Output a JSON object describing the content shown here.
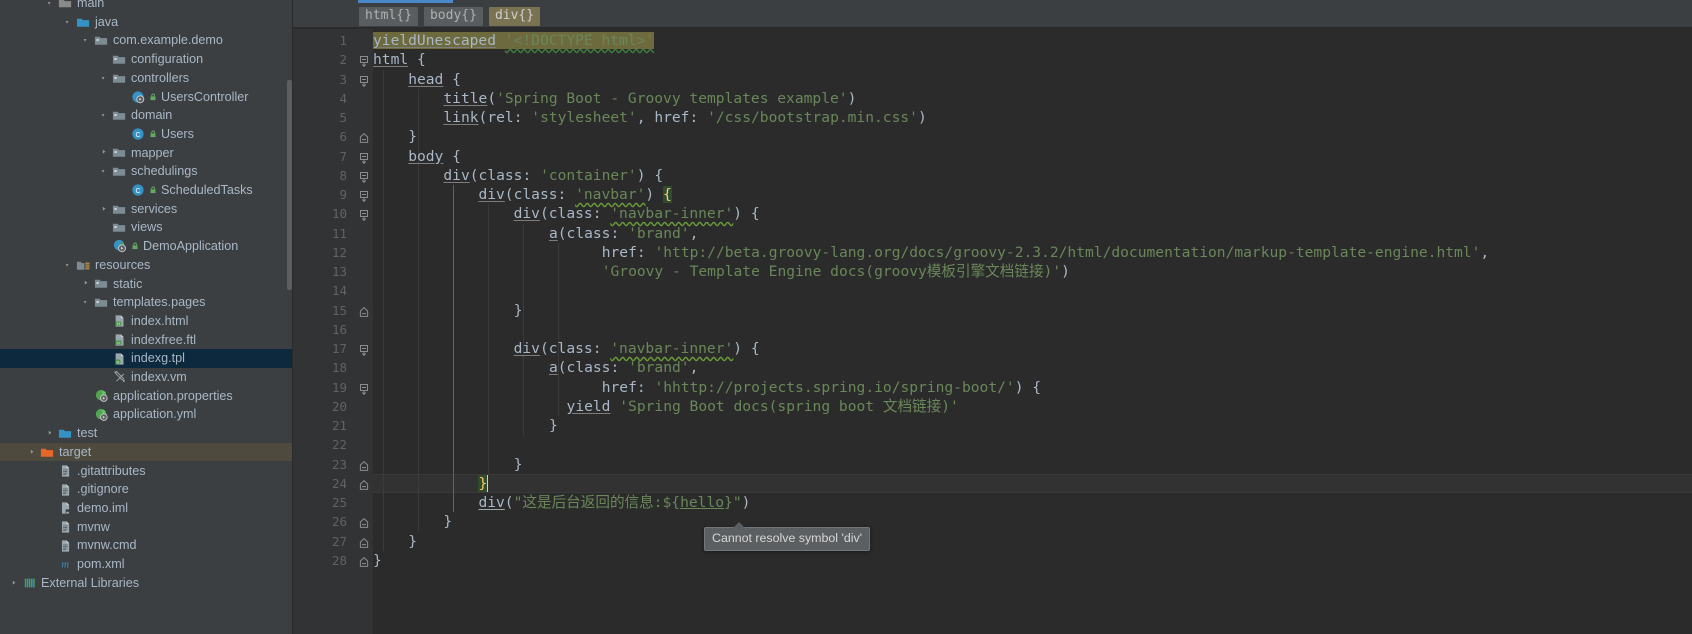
{
  "sidebar": {
    "items": [
      {
        "label": "main",
        "indent": 2,
        "arrow": "down",
        "icon": "folder-module",
        "partial": true
      },
      {
        "label": "java",
        "indent": 3,
        "arrow": "down",
        "icon": "folder-source"
      },
      {
        "label": "com.example.demo",
        "indent": 4,
        "arrow": "down",
        "icon": "folder-package"
      },
      {
        "label": "configuration",
        "indent": 5,
        "arrow": "none",
        "icon": "folder-package"
      },
      {
        "label": "controllers",
        "indent": 5,
        "arrow": "down",
        "icon": "folder-package"
      },
      {
        "label": "UsersController",
        "indent": 6,
        "arrow": "none",
        "icon": "class-run",
        "badge": "lock"
      },
      {
        "label": "domain",
        "indent": 5,
        "arrow": "down",
        "icon": "folder-package"
      },
      {
        "label": "Users",
        "indent": 6,
        "arrow": "none",
        "icon": "class",
        "badge": "lock"
      },
      {
        "label": "mapper",
        "indent": 5,
        "arrow": "right",
        "icon": "folder-package"
      },
      {
        "label": "schedulings",
        "indent": 5,
        "arrow": "down",
        "icon": "folder-package"
      },
      {
        "label": "ScheduledTasks",
        "indent": 6,
        "arrow": "none",
        "icon": "class",
        "badge": "lock"
      },
      {
        "label": "services",
        "indent": 5,
        "arrow": "right",
        "icon": "folder-package"
      },
      {
        "label": "views",
        "indent": 5,
        "arrow": "none",
        "icon": "folder-package"
      },
      {
        "label": "DemoApplication",
        "indent": 5,
        "arrow": "none",
        "icon": "class-run-green",
        "badge": "lock"
      },
      {
        "label": "resources",
        "indent": 3,
        "arrow": "down",
        "icon": "folder-resources"
      },
      {
        "label": "static",
        "indent": 4,
        "arrow": "right",
        "icon": "folder-package"
      },
      {
        "label": "templates.pages",
        "indent": 4,
        "arrow": "down",
        "icon": "folder-package"
      },
      {
        "label": "index.html",
        "indent": 5,
        "arrow": "none",
        "icon": "file-html"
      },
      {
        "label": "indexfree.ftl",
        "indent": 5,
        "arrow": "none",
        "icon": "file-ftl"
      },
      {
        "label": "indexg.tpl",
        "indent": 5,
        "arrow": "none",
        "icon": "file-tpl",
        "selected": true
      },
      {
        "label": "indexv.vm",
        "indent": 5,
        "arrow": "none",
        "icon": "file-vm"
      },
      {
        "label": "application.properties",
        "indent": 4,
        "arrow": "none",
        "icon": "file-spring"
      },
      {
        "label": "application.yml",
        "indent": 4,
        "arrow": "none",
        "icon": "file-spring"
      },
      {
        "label": "test",
        "indent": 2,
        "arrow": "right",
        "icon": "folder-source"
      },
      {
        "label": "target",
        "indent": 1,
        "arrow": "right",
        "icon": "folder-excluded",
        "highlighted": true
      },
      {
        "label": ".gitattributes",
        "indent": 2,
        "arrow": "none",
        "icon": "file-text"
      },
      {
        "label": ".gitignore",
        "indent": 2,
        "arrow": "none",
        "icon": "file-text"
      },
      {
        "label": "demo.iml",
        "indent": 2,
        "arrow": "none",
        "icon": "file-iml"
      },
      {
        "label": "mvnw",
        "indent": 2,
        "arrow": "none",
        "icon": "file-text"
      },
      {
        "label": "mvnw.cmd",
        "indent": 2,
        "arrow": "none",
        "icon": "file-text"
      },
      {
        "label": "pom.xml",
        "indent": 2,
        "arrow": "none",
        "icon": "file-maven"
      },
      {
        "label": "External Libraries",
        "indent": 0,
        "arrow": "right",
        "icon": "libraries"
      }
    ]
  },
  "breadcrumbs": [
    {
      "label": "html{}",
      "active": false
    },
    {
      "label": "body{}",
      "active": false
    },
    {
      "label": "div{}",
      "active": true
    }
  ],
  "editor": {
    "first_line": 1,
    "last_line": 28,
    "caret_line": 24,
    "line_numbers": [
      1,
      2,
      3,
      4,
      5,
      6,
      7,
      8,
      9,
      10,
      11,
      12,
      13,
      14,
      15,
      16,
      17,
      18,
      19,
      20,
      21,
      22,
      23,
      24,
      25,
      26,
      27,
      28
    ],
    "lines": [
      {
        "n": 1,
        "text": "yieldUnescaped '<!DOCTYPE html>'"
      },
      {
        "n": 2,
        "text": "html {"
      },
      {
        "n": 3,
        "text": "    head {"
      },
      {
        "n": 4,
        "text": "        title('Spring Boot - Groovy templates example')"
      },
      {
        "n": 5,
        "text": "        link(rel: 'stylesheet', href: '/css/bootstrap.min.css')"
      },
      {
        "n": 6,
        "text": "    }"
      },
      {
        "n": 7,
        "text": "    body {"
      },
      {
        "n": 8,
        "text": "        div(class: 'container') {"
      },
      {
        "n": 9,
        "text": "            div(class: 'navbar') {"
      },
      {
        "n": 10,
        "text": "                div(class: 'navbar-inner') {"
      },
      {
        "n": 11,
        "text": "                    a(class: 'brand',"
      },
      {
        "n": 12,
        "text": "                          href: 'http://beta.groovy-lang.org/docs/groovy-2.3.2/html/documentation/markup-template-engine.html',"
      },
      {
        "n": 13,
        "text": "                          'Groovy - Template Engine docs(groovy模板引擎文档链接)')"
      },
      {
        "n": 14,
        "text": ""
      },
      {
        "n": 15,
        "text": "                }"
      },
      {
        "n": 16,
        "text": ""
      },
      {
        "n": 17,
        "text": "                div(class: 'navbar-inner') {"
      },
      {
        "n": 18,
        "text": "                    a(class: 'brand',"
      },
      {
        "n": 19,
        "text": "                          href: 'hhttp://projects.spring.io/spring-boot/') {"
      },
      {
        "n": 20,
        "text": "                      yield 'Spring Boot docs(spring boot 文档链接)'"
      },
      {
        "n": 21,
        "text": "                    }"
      },
      {
        "n": 22,
        "text": ""
      },
      {
        "n": 23,
        "text": "                }"
      },
      {
        "n": 24,
        "text": "            }"
      },
      {
        "n": 25,
        "text": "            div(\"这是后台返回的信息:${hello}\")"
      },
      {
        "n": 26,
        "text": "        }"
      },
      {
        "n": 27,
        "text": "    }"
      },
      {
        "n": 28,
        "text": "}"
      }
    ]
  },
  "tooltip": {
    "text": "Cannot resolve symbol 'div'"
  },
  "colors": {
    "background_editor": "#2b2b2b",
    "background_panel": "#3c3f41",
    "gutter": "#313335",
    "text": "#a9b7c6",
    "string": "#6a8759",
    "selection": "#0d293e",
    "tab_accent": "#4a88c7",
    "brace_match": "#ffc66d",
    "breadcrumb_active": "#7a7351"
  }
}
